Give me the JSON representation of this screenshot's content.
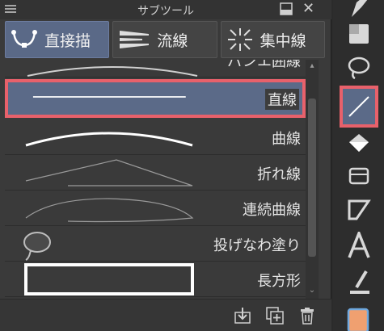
{
  "panel": {
    "title": "サブツール",
    "groups": [
      {
        "label": "直接描",
        "active": true
      },
      {
        "label": "流線",
        "active": false
      },
      {
        "label": "集中線",
        "active": false
      }
    ],
    "items": [
      {
        "label": "パンエ囲線",
        "preview": "arc-partial"
      },
      {
        "label": "直線",
        "preview": "straight-line",
        "selected": true
      },
      {
        "label": "曲線",
        "preview": "curve"
      },
      {
        "label": "折れ線",
        "preview": "polyline"
      },
      {
        "label": "連続曲線",
        "preview": "continuous-curve"
      },
      {
        "label": "投げなわ塗り",
        "preview": "lasso-fill"
      },
      {
        "label": "長方形",
        "preview": "rectangle"
      }
    ],
    "bottom_buttons": [
      "download-icon",
      "add-copy-icon",
      "trash-icon"
    ]
  },
  "toolbar": {
    "tools": [
      {
        "name": "pen-tool-icon"
      },
      {
        "name": "shape-fill-icon"
      },
      {
        "name": "lasso-select-icon"
      },
      {
        "name": "line-tool-icon",
        "selected": true
      },
      {
        "name": "paint-bucket-icon"
      },
      {
        "name": "gradient-icon"
      },
      {
        "name": "frame-border-icon"
      },
      {
        "name": "text-tool-icon"
      },
      {
        "name": "balloon-pen-icon"
      },
      {
        "name": "color-swatch-icon"
      }
    ],
    "accent_color": "#e8616b",
    "swatch_color": "#f0a070"
  }
}
